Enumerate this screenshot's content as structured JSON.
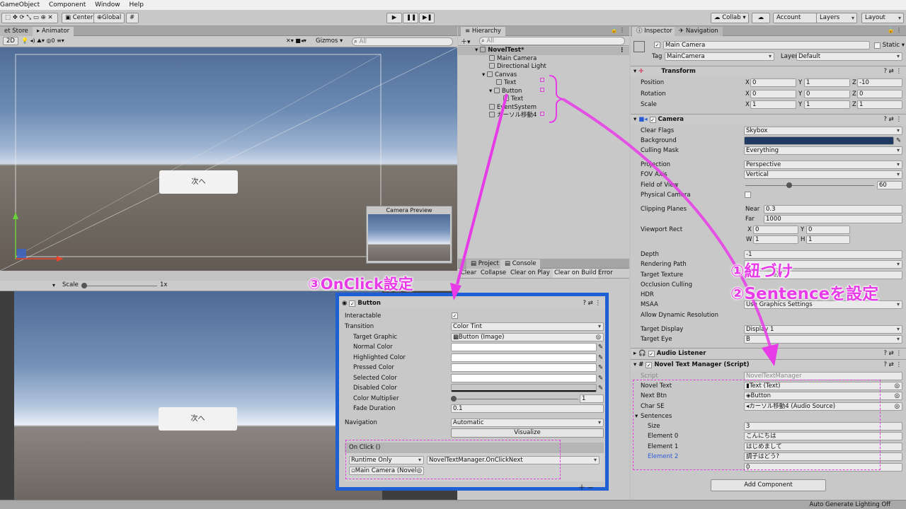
{
  "menu": [
    "GameObject",
    "Component",
    "Window",
    "Help"
  ],
  "toolbar": {
    "center": "Center",
    "global": "Global",
    "collab": "Collab ▾",
    "account": "Account",
    "layers": "Layers",
    "layout": "Layout"
  },
  "scene": {
    "tab_store": "et Store",
    "tab_animator": "Animator",
    "mode_2d": "2D",
    "gizmos": "Gizmos",
    "search_placeholder": "All",
    "next_label": "次へ",
    "camera_preview": "Camera Preview"
  },
  "game": {
    "scale_label": "Scale",
    "scale_value": "1x",
    "next_label": "次へ"
  },
  "hierarchy": {
    "tab": "Hierarchy",
    "search_placeholder": "All",
    "items": [
      {
        "label": "NovelTest*",
        "level": 0
      },
      {
        "label": "Main Camera",
        "level": 1
      },
      {
        "label": "Directional Light",
        "level": 1
      },
      {
        "label": "Canvas",
        "level": 1
      },
      {
        "label": "Text",
        "level": 2
      },
      {
        "label": "Button",
        "level": 2
      },
      {
        "label": "Text",
        "level": 3
      },
      {
        "label": "EventSystem",
        "level": 1
      },
      {
        "label": "カーソル移動4",
        "level": 1
      }
    ]
  },
  "console": {
    "tab_project": "Project",
    "tab_console": "Console",
    "clear": "Clear",
    "collapse": "Collapse",
    "clear_on_play": "Clear on Play",
    "clear_on_build": "Clear on Build",
    "error_pause": "Error Pause"
  },
  "button_inspector": {
    "title": "Button",
    "interactable": "Interactable",
    "transition": "Transition",
    "transition_value": "Color Tint",
    "target_graphic": "Target Graphic",
    "target_graphic_value": "Button (Image)",
    "normal": "Normal Color",
    "highlighted": "Highlighted Color",
    "pressed": "Pressed Color",
    "selected": "Selected Color",
    "disabled": "Disabled Color",
    "color_multiplier": "Color Multiplier",
    "color_multiplier_value": "1",
    "fade_duration": "Fade Duration",
    "fade_duration_value": "0.1",
    "navigation": "Navigation",
    "navigation_value": "Automatic",
    "visualize": "Visualize",
    "on_click": "On Click ()",
    "runtime": "Runtime Only",
    "method": "NovelTextManager.OnClickNext",
    "target_obj": "Main Camera (Novel"
  },
  "inspector": {
    "tab_inspector": "Inspector",
    "tab_navigation": "Navigation",
    "object_name": "Main Camera",
    "static": "Static",
    "tag_label": "Tag",
    "tag": "MainCamera",
    "layer_label": "Layer",
    "layer": "Default",
    "transform": {
      "title": "Transform",
      "position": "Position",
      "rotation": "Rotation",
      "scale": "Scale",
      "pos": [
        "0",
        "1",
        "-10"
      ],
      "rot": [
        "0",
        "0",
        "0"
      ],
      "scl": [
        "1",
        "1",
        "1"
      ]
    },
    "camera": {
      "title": "Camera",
      "clear_flags": "Clear Flags",
      "clear_flags_value": "Skybox",
      "background": "Background",
      "culling_mask": "Culling Mask",
      "culling_mask_value": "Everything",
      "projection": "Projection",
      "projection_value": "Perspective",
      "fov_axis": "FOV Axis",
      "fov_axis_value": "Vertical",
      "fov": "Field of View",
      "fov_value": "60",
      "physical": "Physical Camera",
      "clipping": "Clipping Planes",
      "near": "Near",
      "near_value": "0.3",
      "far": "Far",
      "far_value": "1000",
      "viewport": "Viewport Rect",
      "vx": "0",
      "vy": "0",
      "vw": "1",
      "vh": "1",
      "depth": "Depth",
      "depth_value": "-1",
      "rendering_path": "Rendering Path",
      "target_texture": "Target Texture",
      "target_texture_value": "e)",
      "occlusion": "Occlusion Culling",
      "hdr": "HDR",
      "msaa": "MSAA",
      "msaa_value": "Use Graphics Settings",
      "dynamic_res": "Allow Dynamic Resolution",
      "target_display": "Target Display",
      "target_display_value": "Display 1",
      "target_eye": "Target Eye",
      "target_eye_value": "B"
    },
    "audio_listener": "Audio Listener",
    "novel": {
      "title": "Novel Text Manager (Script)",
      "script": "Script",
      "script_value": "NovelTextManager",
      "novel_text": "Novel Text",
      "novel_text_value": "Text (Text)",
      "next_btn": "Next Btn",
      "next_btn_value": "Button",
      "char_se": "Char SE",
      "char_se_value": "カーソル移動4 (Audio Source)",
      "sentences": "Sentences",
      "size": "Size",
      "size_value": "3",
      "elements": [
        {
          "label": "Element 0",
          "value": "こんにちは"
        },
        {
          "label": "Element 1",
          "value": "はじめまして"
        },
        {
          "label": "Element 2",
          "value": "調子はどう?"
        }
      ],
      "extra_value": "0"
    },
    "add_component": "Add Component"
  },
  "status": "Auto Generate Lighting Off",
  "annotations": {
    "onclick": "③OnClick設定",
    "link": "①紐づけ",
    "sentence": "②Sentenceを設定"
  },
  "colors": {
    "annotation": "#e83be8",
    "highlight_frame": "#1f5fd4"
  }
}
